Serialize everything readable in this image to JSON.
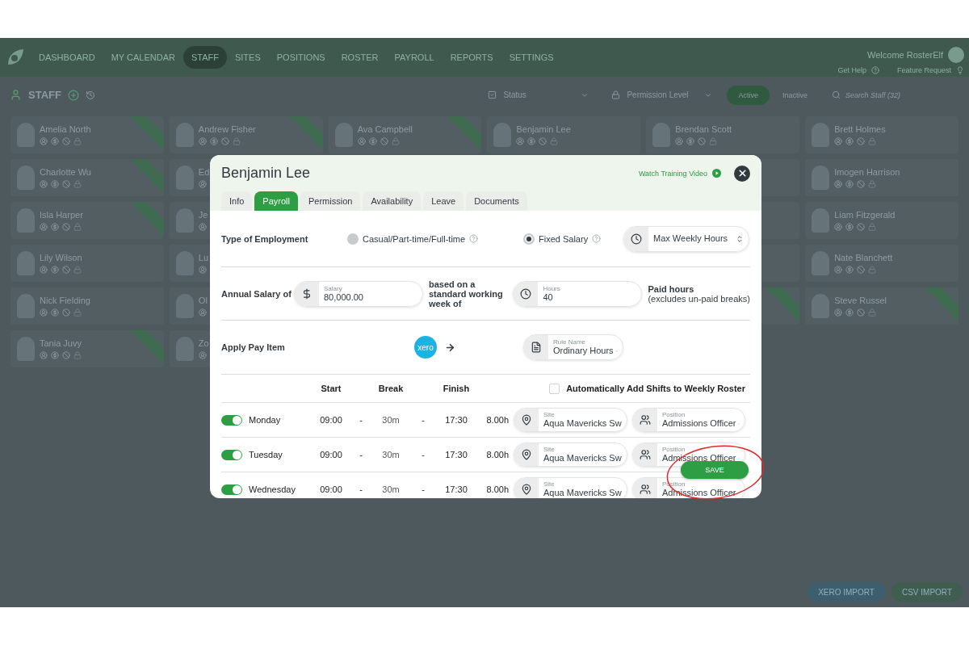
{
  "nav": {
    "items": [
      {
        "label": "DASHBOARD",
        "selected": false
      },
      {
        "label": "MY CALENDAR",
        "selected": false
      },
      {
        "label": "STAFF",
        "selected": true
      },
      {
        "label": "SITES",
        "selected": false
      },
      {
        "label": "POSITIONS",
        "selected": false
      },
      {
        "label": "ROSTER",
        "selected": false
      },
      {
        "label": "PAYROLL",
        "selected": false
      },
      {
        "label": "REPORTS",
        "selected": false
      },
      {
        "label": "SETTINGS",
        "selected": false
      }
    ],
    "welcome": "Welcome RosterElf",
    "links": [
      "Get Help",
      "Feature Request"
    ]
  },
  "staff_header": {
    "title": "STAFF",
    "filters": [
      "Status",
      "Permission Level"
    ],
    "toggle": [
      {
        "label": "Active",
        "selected": true
      },
      {
        "label": "Inactive",
        "selected": false
      }
    ],
    "search": {
      "placeholder": "Search Staff (32)"
    }
  },
  "staff_columns": [
    [
      {
        "name": "Amelia North",
        "ribbon": true
      },
      {
        "name": "Charlotte Wu",
        "ribbon": true
      },
      {
        "name": "Isla Harper",
        "ribbon": true
      },
      {
        "name": "Lily Wilson",
        "ribbon": false
      },
      {
        "name": "Nick Fielding",
        "ribbon": false
      },
      {
        "name": "Tania Juvy",
        "ribbon": true
      }
    ],
    [
      {
        "name": "Andrew Fisher",
        "ribbon": true
      },
      {
        "name": "Ed",
        "ribbon": false
      },
      {
        "name": "Je",
        "ribbon": false
      },
      {
        "name": "Lu",
        "ribbon": false
      },
      {
        "name": "Ol",
        "ribbon": false
      },
      {
        "name": "Zo",
        "ribbon": false
      }
    ],
    [
      {
        "name": "Ava Campbell",
        "ribbon": true
      }
    ],
    [
      {
        "name": "Benjamin Lee",
        "ribbon": false
      }
    ],
    [
      {
        "name": "Brendan Scott",
        "ribbon": false
      },
      {
        "ribbon": false
      },
      {
        "ribbon": false
      },
      {
        "ribbon": false
      },
      {
        "ribbon": true
      }
    ],
    [
      {
        "name": "Brett Holmes",
        "ribbon": false
      },
      {
        "name": "Imogen Harrison",
        "ribbon": false
      },
      {
        "name": "Liam Fitzgerald",
        "ribbon": false
      },
      {
        "name": "Nate Blanchett",
        "ribbon": false
      },
      {
        "name": "Steve Russel",
        "ribbon": true
      }
    ]
  ],
  "imports": [
    {
      "label": "XERO IMPORT",
      "color": "#3d5f6d"
    },
    {
      "label": "CSV IMPORT",
      "color": "#3f5e50"
    }
  ],
  "modal": {
    "title": "Benjamin Lee",
    "video_link": "Watch Training Video",
    "tabs": [
      {
        "label": "Info",
        "selected": false
      },
      {
        "label": "Payroll",
        "selected": true
      },
      {
        "label": "Permission",
        "selected": false
      },
      {
        "label": "Availability",
        "selected": false
      },
      {
        "label": "Leave",
        "selected": false
      },
      {
        "label": "Documents",
        "selected": false
      }
    ],
    "employment": {
      "label": "Type of Employment",
      "options": [
        {
          "label": "Casual/Part-time/Full-time",
          "selected": false
        },
        {
          "label": "Fixed Salary",
          "selected": true
        }
      ],
      "max_hours": {
        "value": "Max Weekly Hours"
      }
    },
    "salary": {
      "label": "Annual Salary of",
      "field": {
        "label": "Salary",
        "value": "80,000.00"
      },
      "middle": "based on a standard working week of",
      "hours": {
        "label": "Hours",
        "value": "40"
      },
      "paid": "Paid hours",
      "paid_note": "(excludes un-paid breaks)"
    },
    "pay_item": {
      "label": "Apply Pay Item",
      "logo_text": "xero",
      "rule": {
        "label": "Rule Name",
        "value": "Ordinary Hours"
      }
    },
    "schedule": {
      "columns": [
        "Start",
        "Break",
        "Finish"
      ],
      "separator": "-",
      "auto_add": {
        "label": "Automatically Add Shifts to Weekly Roster",
        "checked": false
      },
      "days": [
        {
          "day": "Monday",
          "on": true,
          "start": "09:00",
          "break": "30m",
          "finish": "17:30",
          "hours": "8.00h",
          "site": {
            "label": "Site",
            "value": "Aqua Mavericks Sw"
          },
          "position": {
            "label": "Position",
            "value": "Admissions Officer"
          }
        },
        {
          "day": "Tuesday",
          "on": true,
          "start": "09:00",
          "break": "30m",
          "finish": "17:30",
          "hours": "8.00h",
          "site": {
            "label": "Site",
            "value": "Aqua Mavericks Sw"
          },
          "position": {
            "label": "Position",
            "value": "Admissions Officer"
          }
        },
        {
          "day": "Wednesday",
          "on": true,
          "start": "09:00",
          "break": "30m",
          "finish": "17:30",
          "hours": "8.00h",
          "site": {
            "label": "Site",
            "value": "Aqua Mavericks Sw"
          },
          "position": {
            "label": "Position",
            "value": "Admissions Officer"
          }
        }
      ]
    },
    "save": "SAVE"
  }
}
